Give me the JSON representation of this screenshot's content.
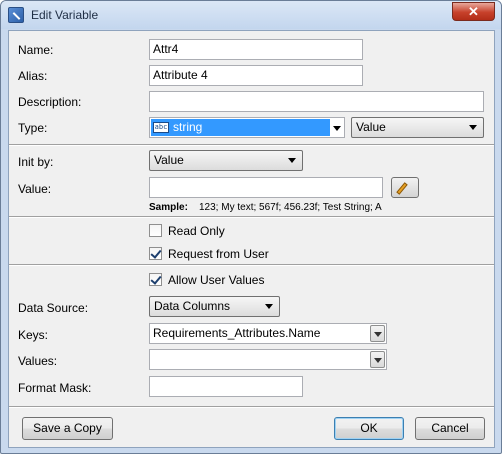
{
  "window": {
    "title": "Edit Variable",
    "close_glyph": "✕"
  },
  "fields": {
    "name_label": "Name:",
    "name_value": "Attr4",
    "alias_label": "Alias:",
    "alias_value": "Attribute 4",
    "description_label": "Description:",
    "description_value": "",
    "type_label": "Type:",
    "type_icon_text": "abc",
    "type_value": "string",
    "type_mode_value": "Value"
  },
  "init": {
    "init_by_label": "Init by:",
    "init_by_value": "Value",
    "value_label": "Value:",
    "value_value": "",
    "sample_label": "Sample:",
    "sample_text": "123; My text; 567f; 456.23f; Test String; A"
  },
  "options": {
    "read_only_label": "Read Only",
    "read_only_checked": false,
    "request_from_user_label": "Request from User",
    "request_from_user_checked": true
  },
  "data_source": {
    "allow_user_values_label": "Allow User Values",
    "allow_user_values_checked": true,
    "data_source_label": "Data Source:",
    "data_source_value": "Data Columns",
    "keys_label": "Keys:",
    "keys_value": "Requirements_Attributes.Name",
    "values_label": "Values:",
    "values_value": "",
    "format_mask_label": "Format Mask:",
    "format_mask_value": ""
  },
  "buttons": {
    "save_copy": "Save a Copy",
    "ok": "OK",
    "cancel": "Cancel"
  }
}
